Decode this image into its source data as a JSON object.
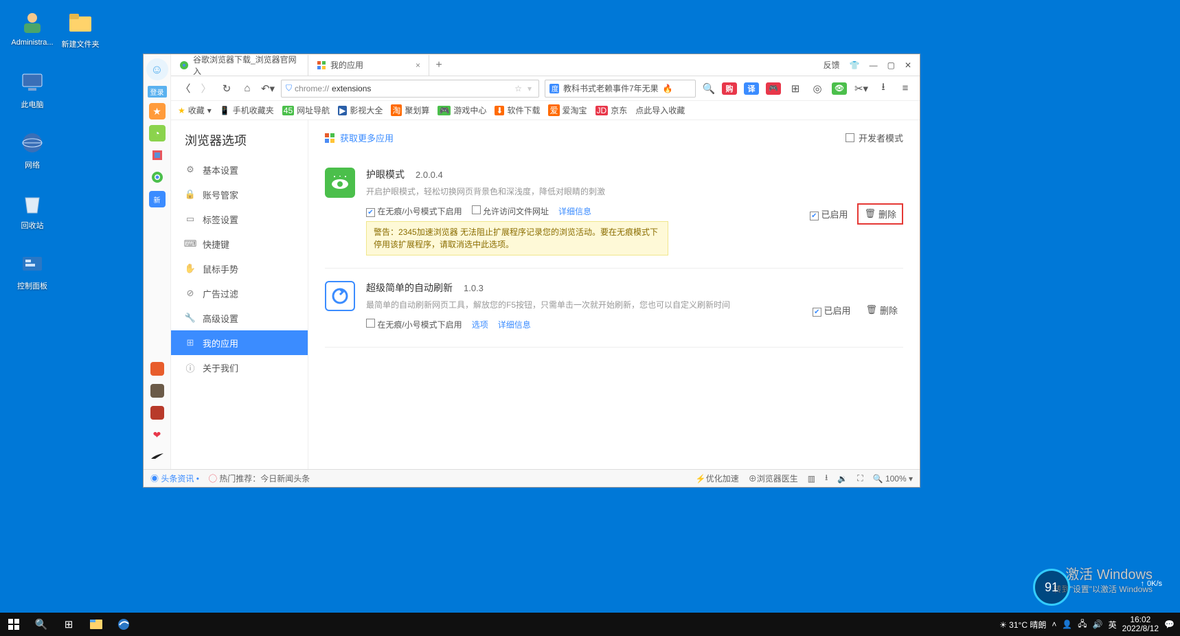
{
  "desktop": {
    "icons": [
      "Administra...",
      "新建文件夹",
      "此电脑",
      "网络",
      "回收站",
      "控制面板"
    ]
  },
  "browser": {
    "login": "登录",
    "feedback": "反馈",
    "tabs": [
      {
        "title": "谷歌浏览器下载_浏览器官网入",
        "active": false
      },
      {
        "title": "我的应用",
        "active": true
      }
    ],
    "nav": {
      "url_prefix": "chrome://",
      "url_bold": "extensions",
      "headline": "教科书式老赖事件7年无果"
    },
    "toolbar_chips": [
      "购",
      "译"
    ],
    "bookmarks": {
      "fav": "收藏",
      "items": [
        "手机收藏夹",
        "网址导航",
        "影视大全",
        "聚划算",
        "游戏中心",
        "软件下载",
        "爱淘宝",
        "京东",
        "点此导入收藏"
      ]
    },
    "sidebar": {
      "heading": "浏览器选项",
      "items": [
        "基本设置",
        "账号管家",
        "标签设置",
        "快捷键",
        "鼠标手势",
        "广告过滤",
        "高级设置",
        "我的应用",
        "关于我们"
      ],
      "active": 7
    },
    "pane": {
      "more_apps": "获取更多应用",
      "dev_mode": "开发者模式",
      "enabled": "已启用",
      "delete": "删除",
      "opt_incog": "在无痕/小号模式下启用",
      "opt_file": "允许访问文件网址",
      "opt_lnk": "详细信息",
      "opt_options": "选项",
      "extensions": [
        {
          "name": "护眼模式",
          "version": "2.0.0.4",
          "desc": "开启护眼模式，轻松切换网页背景色和深浅度，降低对眼睛的刺激",
          "color": "#4bbf4b",
          "show_file": true,
          "warn": "警告：2345加速浏览器 无法阻止扩展程序记录您的浏览活动。要在无痕模式下停用该扩展程序，请取消选中此选项。",
          "incog_checked": true,
          "del_highlight": true
        },
        {
          "name": "超级简单的自动刷新",
          "version": "1.0.3",
          "desc": "最简单的自动刷新网页工具，解放您的F5按钮，只需单击一次就开始刷新，您也可以自定义刷新时间",
          "color": "#3b8cff",
          "show_file": false,
          "show_options": true,
          "incog_checked": false
        }
      ]
    },
    "statusbar": {
      "news": "头条资讯",
      "hot": "热门推荐：今日新闻头条",
      "opt": "优化加速",
      "doctor": "浏览器医生",
      "zoom": "100%"
    }
  },
  "overlay": {
    "line1": "激活 Windows",
    "line2": "转到\"设置\"以激活 Windows"
  },
  "gauge": "91",
  "netspd": "0K/s",
  "taskbar": {
    "weather": "31°C 晴朗",
    "ime": "英",
    "time": "16:02",
    "date": "2022/8/12"
  }
}
